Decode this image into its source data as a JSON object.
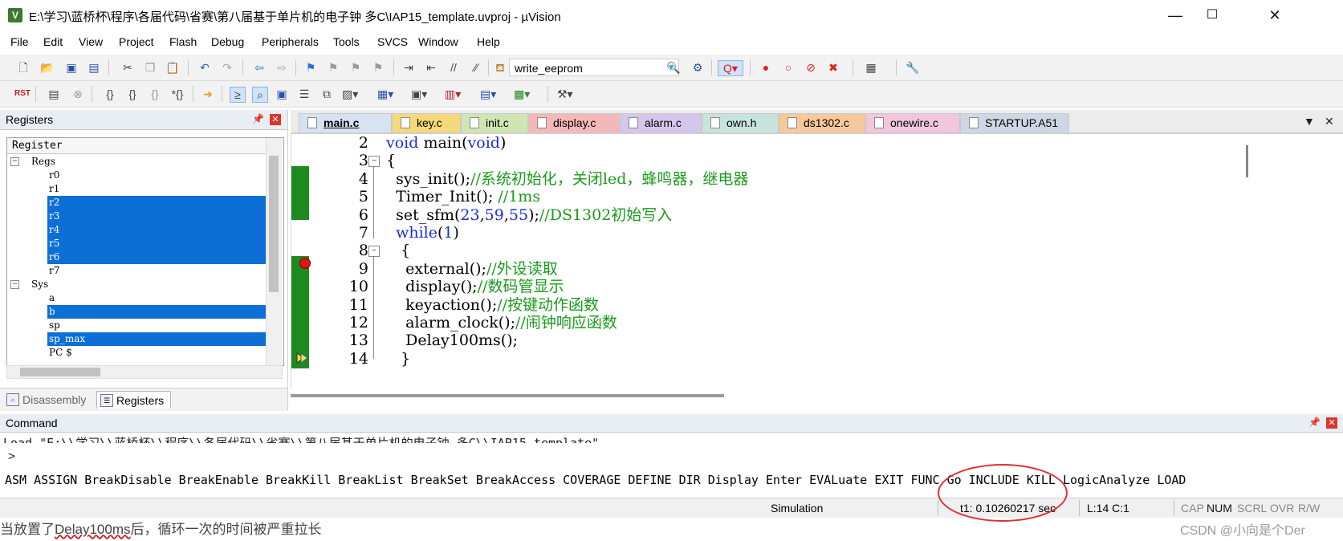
{
  "window": {
    "app_icon_letter": "V",
    "title": "E:\\学习\\蓝桥杯\\程序\\各届代码\\省赛\\第八届基于单片机的电子钟 多C\\IAP15_template.uvproj - µVision",
    "minimize": "—",
    "maximize": "☐",
    "close": "✕"
  },
  "menu": [
    "File",
    "Edit",
    "View",
    "Project",
    "Flash",
    "Debug",
    "Peripherals",
    "Tools",
    "SVCS",
    "Window",
    "Help"
  ],
  "toolbar": {
    "target": "write_eeprom"
  },
  "registers_pane": {
    "title": "Registers",
    "column_header": "Register",
    "groups": [
      {
        "name": "Regs",
        "items": [
          {
            "label": "r0",
            "selected": false
          },
          {
            "label": "r1",
            "selected": false
          },
          {
            "label": "r2",
            "selected": true
          },
          {
            "label": "r3",
            "selected": true
          },
          {
            "label": "r4",
            "selected": true
          },
          {
            "label": "r5",
            "selected": true
          },
          {
            "label": "r6",
            "selected": true
          },
          {
            "label": "r7",
            "selected": false
          }
        ]
      },
      {
        "name": "Sys",
        "items": [
          {
            "label": "a",
            "selected": false
          },
          {
            "label": "b",
            "selected": true
          },
          {
            "label": "sp",
            "selected": false
          },
          {
            "label": "sp_max",
            "selected": true
          },
          {
            "label": "PC  $",
            "selected": false
          }
        ]
      }
    ],
    "tabs": [
      "Disassembly",
      "Registers"
    ]
  },
  "editor": {
    "tabs": [
      {
        "label": "main.c",
        "color": "#d7e3f2",
        "active": true
      },
      {
        "label": "key.c",
        "color": "#f5d97a"
      },
      {
        "label": "init.c",
        "color": "#cfe6b4"
      },
      {
        "label": "display.c",
        "color": "#f4b8b8"
      },
      {
        "label": "alarm.c",
        "color": "#d6c6ec"
      },
      {
        "label": "own.h",
        "color": "#c6e4dc"
      },
      {
        "label": "ds1302.c",
        "color": "#f7c99a"
      },
      {
        "label": "onewire.c",
        "color": "#f2c6dc"
      },
      {
        "label": "STARTUP.A51",
        "color": "#cfd6e6"
      }
    ],
    "lines": [
      {
        "n": "2",
        "code": "void main(void)"
      },
      {
        "n": "3",
        "code": "{"
      },
      {
        "n": "4",
        "code": "  sys_init();//系统初始化，关闭led，蜂鸣器，继电器"
      },
      {
        "n": "5",
        "code": "  Timer_Init(); //1ms"
      },
      {
        "n": "6",
        "code": "  set_sfm(23,59,55);//DS1302初始写入"
      },
      {
        "n": "7",
        "code": "  while(1)"
      },
      {
        "n": "8",
        "code": "   {"
      },
      {
        "n": "9",
        "code": "    external();//外设读取"
      },
      {
        "n": "10",
        "code": "    display();//数码管显示"
      },
      {
        "n": "11",
        "code": "    keyaction();//按键动作函数"
      },
      {
        "n": "12",
        "code": "    alarm_clock();//闹钟响应函数"
      },
      {
        "n": "13",
        "code": "    Delay100ms();"
      },
      {
        "n": "14",
        "code": "   }"
      }
    ]
  },
  "command_pane": {
    "title": "Command",
    "output": "Load \"E:\\\\学习\\\\蓝桥杯\\\\程序\\\\各届代码\\\\省赛\\\\第八届基于单片机的电子钟 多C\\\\IAP15_template\"",
    "prompt": ">",
    "keywords": [
      "ASM",
      "ASSIGN",
      "BreakDisable",
      "BreakEnable",
      "BreakKill",
      "BreakList",
      "BreakSet",
      "BreakAccess",
      "COVERAGE",
      "DEFINE",
      "DIR",
      "Display",
      "Enter",
      "EVALuate",
      "EXIT",
      "FUNC",
      "Go",
      "INCLUDE",
      "KILL",
      "LogicAnalyze",
      "LOAD"
    ]
  },
  "status": {
    "mode": "Simulation",
    "time": "t1: 0.10260217 sec",
    "position": "L:14 C:1",
    "keys": [
      {
        "label": "CAP",
        "on": false
      },
      {
        "label": "NUM",
        "on": true
      },
      {
        "label": "SCRL",
        "on": false
      },
      {
        "label": "OVR",
        "on": false
      },
      {
        "label": "R/W",
        "on": false
      }
    ]
  },
  "below": {
    "note_prefix": "当放置了",
    "note_func": "Delay100ms",
    "note_suffix": "后，循环一次的时间被严重拉长",
    "watermark": "CSDN @小向是个Der"
  }
}
